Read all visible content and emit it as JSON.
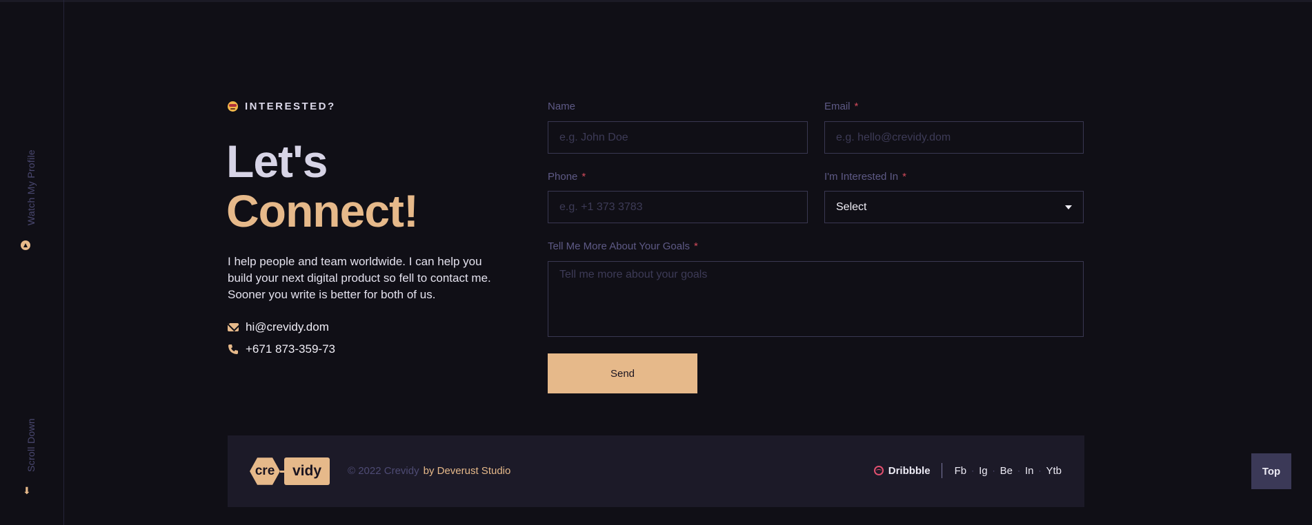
{
  "sidebar": {
    "watch_label": "Watch My Profile",
    "scroll_label": "Scroll Down"
  },
  "intro": {
    "eyebrow": "INTERESTED?",
    "headline_line1": "Let's",
    "headline_line2": "Connect!",
    "description": "I help people and team worldwide. I can help you build your next digital product so fell to contact me. Sooner you write is better for both of us.",
    "email": "hi@crevidy.dom",
    "phone": "+671 873-359-73"
  },
  "form": {
    "name_label": "Name",
    "name_placeholder": "e.g. John Doe",
    "email_label": "Email",
    "email_placeholder": "e.g. hello@crevidy.dom",
    "phone_label": "Phone",
    "phone_placeholder": "e.g. +1 373 3783",
    "interest_label": "I'm Interested In",
    "interest_value": "Select",
    "goals_label": "Tell Me More About Your Goals",
    "goals_placeholder": "Tell me more about your goals",
    "required_mark": "*",
    "send_label": "Send"
  },
  "footer": {
    "logo_left": "cre",
    "logo_right": "vidy",
    "copyright": "© 2022 Crevidy",
    "studio": "by Deverust Studio",
    "dribbble": "Dribbble",
    "socials": [
      "Fb",
      "Ig",
      "Be",
      "In",
      "Ytb"
    ],
    "separator": "·"
  },
  "top_button": "Top",
  "colors": {
    "background": "#100f16",
    "accent": "#e6b98a",
    "required": "#d04a5a",
    "footer_bg": "#1c1a28"
  }
}
